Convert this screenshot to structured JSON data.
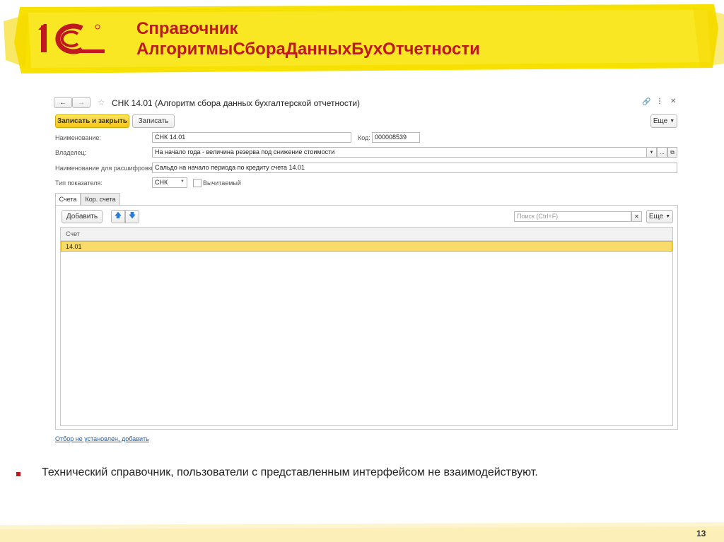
{
  "slide": {
    "title_line1": "Справочник",
    "title_line2": "АлгоритмыСбораДанныхБухОтчетности",
    "bullet": "Технический справочник, пользователи с представленным интерфейсом не взаимодействуют.",
    "page_number": "13",
    "logo_text": "1С"
  },
  "window": {
    "title": "СНК 14.01 (Алгоритм сбора данных бухгалтерской отчетности)",
    "buttons": {
      "save_close": "Записать и закрыть",
      "save": "Записать",
      "more": "Еще"
    },
    "fields": {
      "name_label": "Наименование:",
      "name_value": "СНК 14.01",
      "code_label": "Код:",
      "code_value": "000008539",
      "owner_label": "Владелец:",
      "owner_value": "На начало года - величина резерва под снижение стоимости",
      "decode_label": "Наименование для расшифровки:",
      "decode_value": "Сальдо на начало периода по кредиту счета 14.01",
      "type_label": "Тип показателя:",
      "type_value": "СНК",
      "deductible_label": "Вычитаемый"
    },
    "tabs": [
      "Счета",
      "Кор. счета"
    ],
    "table_toolbar": {
      "add": "Добавить",
      "search_placeholder": "Поиск (Ctrl+F)",
      "more": "Еще"
    },
    "table": {
      "column": "Счет",
      "rows": [
        "14.01"
      ]
    },
    "filter_link": "Отбор не установлен, добавить"
  },
  "colors": {
    "accent_red": "#c0181f",
    "yellow": "#f5d800",
    "selection": "#f8db6a"
  }
}
